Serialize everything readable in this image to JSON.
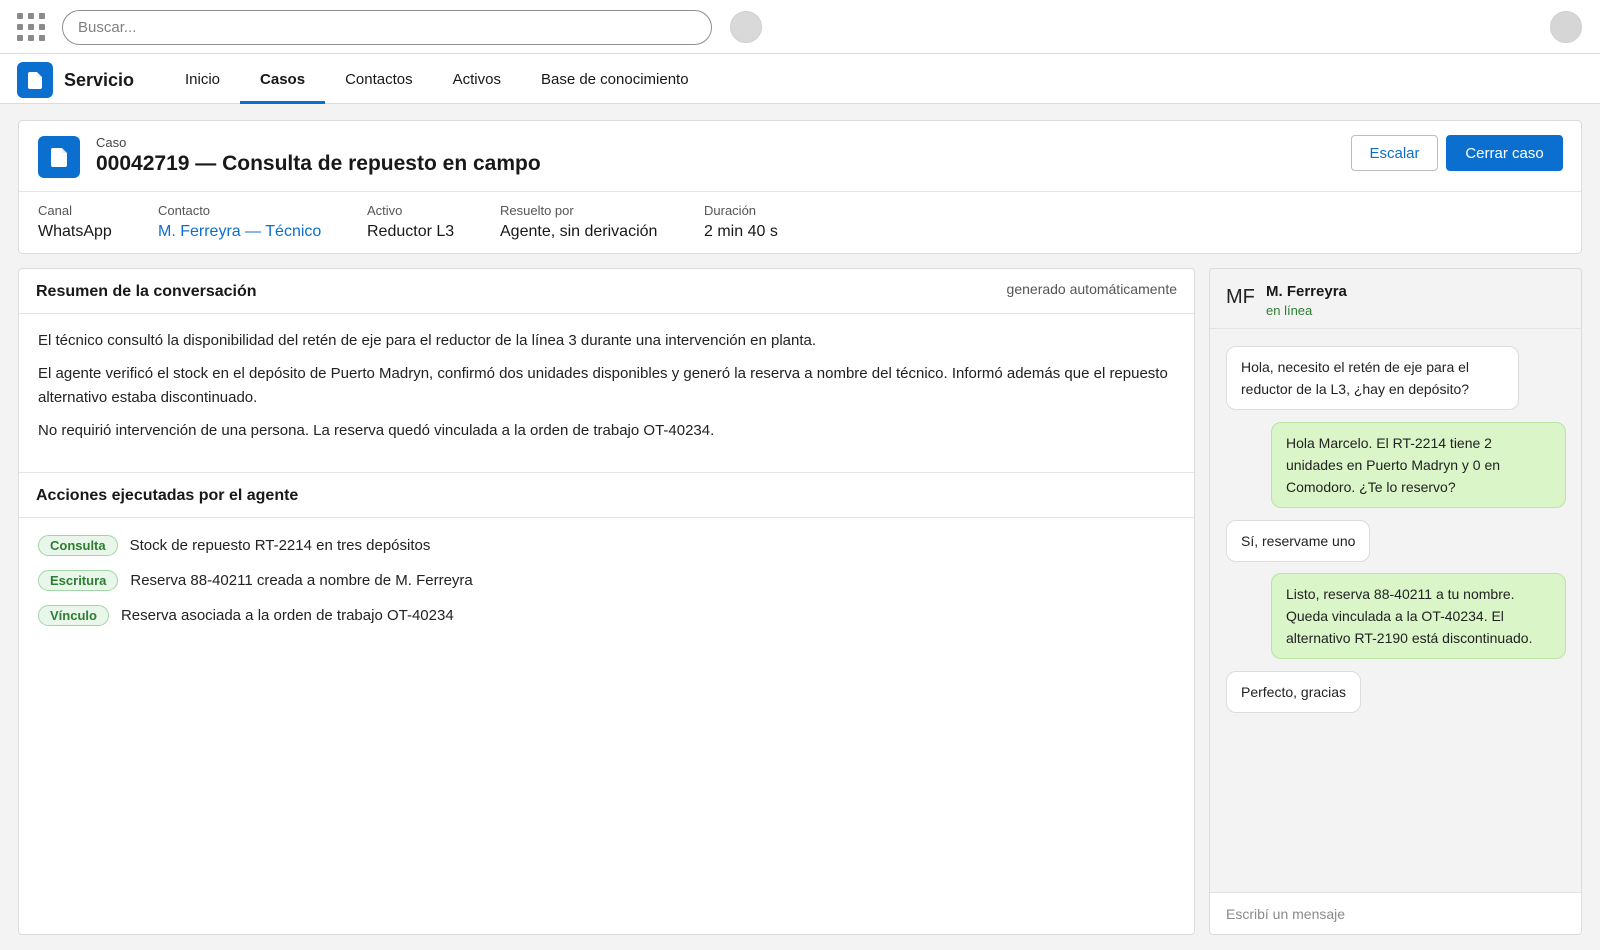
{
  "topbar": {
    "search_placeholder": "Buscar...",
    "icons": [
      "app-launcher-icon",
      "notification-icon",
      "user-avatar"
    ]
  },
  "navbar": {
    "app_name": "Servicio",
    "tabs": [
      {
        "label": "Inicio",
        "active": false
      },
      {
        "label": "Casos",
        "active": true
      },
      {
        "label": "Contactos",
        "active": false
      },
      {
        "label": "Activos",
        "active": false
      },
      {
        "label": "Base de conocimiento",
        "active": false
      }
    ]
  },
  "case": {
    "type_label": "Caso",
    "title": "00042719 — Consulta de repuesto en campo",
    "escalate_label": "Escalar",
    "close_label": "Cerrar caso",
    "fields": [
      {
        "label": "Canal",
        "value": "WhatsApp"
      },
      {
        "label": "Contacto",
        "value": "M. Ferreyra — Técnico"
      },
      {
        "label": "Activo",
        "value": "Reductor L3"
      },
      {
        "label": "Resuelto por",
        "value": "Agente, sin derivación"
      },
      {
        "label": "Duración",
        "value": "2 min 40 s"
      }
    ]
  },
  "summary": {
    "title": "Resumen de la conversación",
    "note": "generado automáticamente",
    "paragraphs": [
      "El técnico consultó la disponibilidad del retén de eje para el reductor de la línea 3 durante una intervención en planta.",
      "El agente verificó el stock en el depósito de Puerto Madryn, confirmó dos unidades disponibles y generó la reserva a nombre del técnico. Informó además que el repuesto alternativo estaba discontinuado.",
      "No requirió intervención de una persona. La reserva quedó vinculada a la orden de trabajo OT-40234."
    ]
  },
  "actions": {
    "title": "Acciones ejecutadas por el agente",
    "items": [
      {
        "badge": "Consulta",
        "text": "Stock de repuesto RT-2214 en tres depósitos"
      },
      {
        "badge": "Escritura",
        "text": "Reserva 88-40211 creada a nombre de M. Ferreyra"
      },
      {
        "badge": "Vínculo",
        "text": "Reserva asociada a la orden de trabajo OT-40234"
      }
    ]
  },
  "chat": {
    "avatar_initials": "MF",
    "name": "M. Ferreyra",
    "status": "en línea",
    "messages": [
      {
        "from": "contact",
        "text": "Hola, necesito el retén de eje para el reductor de la L3, ¿hay en depósito?"
      },
      {
        "from": "agent",
        "text": "Hola Marcelo. El RT-2214 tiene 2 unidades en Puerto Madryn y 0 en Comodoro. ¿Te lo reservo?"
      },
      {
        "from": "contact",
        "text": "Sí, reservame uno"
      },
      {
        "from": "agent",
        "text": "Listo, reserva 88-40211 a tu nombre. Queda vinculada a la OT-40234. El alternativo RT-2190 está discontinuado."
      },
      {
        "from": "contact",
        "text": "Perfecto, gracias"
      }
    ],
    "input_placeholder": "Escribí un mensaje"
  },
  "colors": {
    "brand": "#0b6fd0",
    "badge_bg": "#e9f6ea",
    "badge_text": "#2e7d32",
    "outgoing_bubble": "#daf5c8",
    "status_online": "#2e7d32"
  }
}
